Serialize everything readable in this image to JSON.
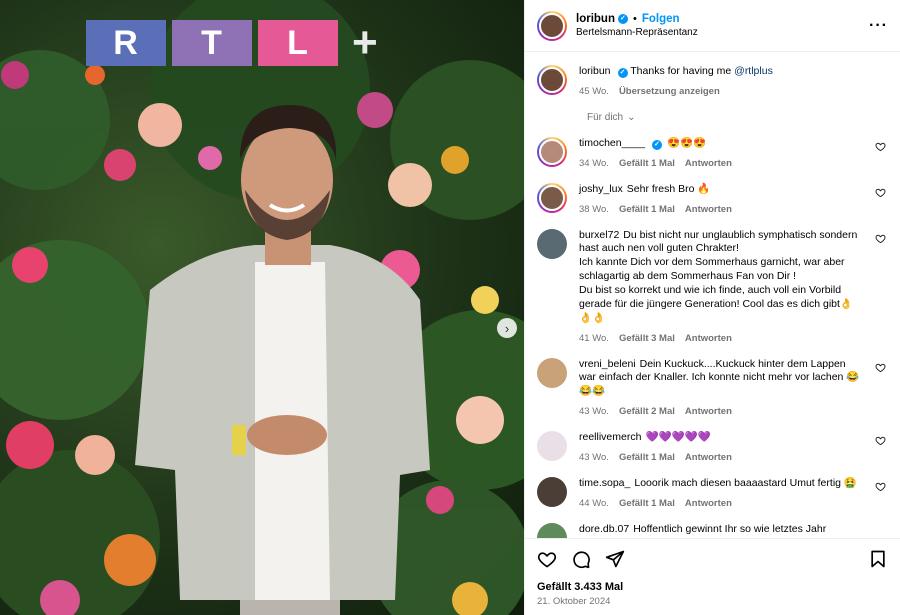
{
  "media": {
    "logo": {
      "letters": [
        {
          "text": "R",
          "color": "#5b6fb8"
        },
        {
          "text": "T",
          "color": "#8f72b6"
        },
        {
          "text": "L",
          "color": "#e55a96"
        }
      ],
      "plus": "+"
    },
    "next_icon": "chevron-right-icon"
  },
  "header": {
    "username": "loribun",
    "follow_label": "Folgen",
    "separator": "•",
    "subtitle": "Bertelsmann-Repräsentanz",
    "more_icon": "more-horizontal-icon",
    "avatar_color": "#6b4a3a"
  },
  "caption": {
    "username": "loribun",
    "text": "Thanks for having me",
    "mention": "@rtlplus",
    "time": "45 Wo.",
    "translate_label": "Übersetzung anzeigen"
  },
  "sort": {
    "label": "Für dich",
    "icon": "chevron-down-icon"
  },
  "comments": [
    {
      "username": "timochen____",
      "verified": true,
      "text": "😍😍😍",
      "time": "34 Wo.",
      "likes": "Gefällt 1 Mal",
      "reply": "Antworten",
      "story": true,
      "avatar_color": "#b58a7a"
    },
    {
      "username": "joshy_lux",
      "verified": false,
      "text": "Sehr fresh Bro 🔥",
      "time": "38 Wo.",
      "likes": "Gefällt 1 Mal",
      "reply": "Antworten",
      "story": true,
      "avatar_color": "#7a5b4a"
    },
    {
      "username": "burxel72",
      "verified": false,
      "text": "Du bist nicht nur unglaublich symphatisch sondern hast auch nen voll guten Chrakter!\nIch kannte Dich vor dem Sommerhaus garnicht, war aber schlagartig ab dem Sommerhaus Fan von Dir !\nDu bist so korrekt und wie ich finde, auch voll ein Vorbild gerade für die jüngere Generation! Cool das es dich gibt👌👌👌",
      "time": "41 Wo.",
      "likes": "Gefällt 3 Mal",
      "reply": "Antworten",
      "story": false,
      "avatar_color": "#5a6a72"
    },
    {
      "username": "vreni_beleni",
      "verified": false,
      "text": "Dein Kuckuck....Kuckuck hinter dem Lappen war einfach der Knaller. Ich konnte nicht mehr vor lachen 😂😂😂",
      "time": "43 Wo.",
      "likes": "Gefällt 2 Mal",
      "reply": "Antworten",
      "story": false,
      "avatar_color": "#c9a27a"
    },
    {
      "username": "reellivemerch",
      "verified": false,
      "text": "💜💜💜💜💜",
      "time": "43 Wo.",
      "likes": "Gefällt 1 Mal",
      "reply": "Antworten",
      "story": false,
      "avatar_color": "#e8e0e6"
    },
    {
      "username": "time.sopa_",
      "verified": false,
      "text": "Looorik mach diesen baaaastard Umut fertig 🤮",
      "time": "44 Wo.",
      "likes": "Gefällt 1 Mal",
      "reply": "Antworten",
      "story": false,
      "avatar_color": "#4a3e36"
    },
    {
      "username": "dore.db.07",
      "verified": false,
      "text": "Hoffentlich gewinnt Ihr so wie letztes Jahr Serkan",
      "time": "",
      "likes": "",
      "reply": "",
      "story": false,
      "avatar_color": "#5f8a5a"
    }
  ],
  "actions": {
    "like_icon": "heart-icon",
    "comment_icon": "comment-icon",
    "share_icon": "share-icon",
    "save_icon": "bookmark-icon",
    "likes_text": "Gefällt 3.433 Mal",
    "date": "21. Oktober 2024"
  },
  "colors": {
    "accent": "#0095f6",
    "muted": "#737373",
    "mention": "#00376b"
  }
}
